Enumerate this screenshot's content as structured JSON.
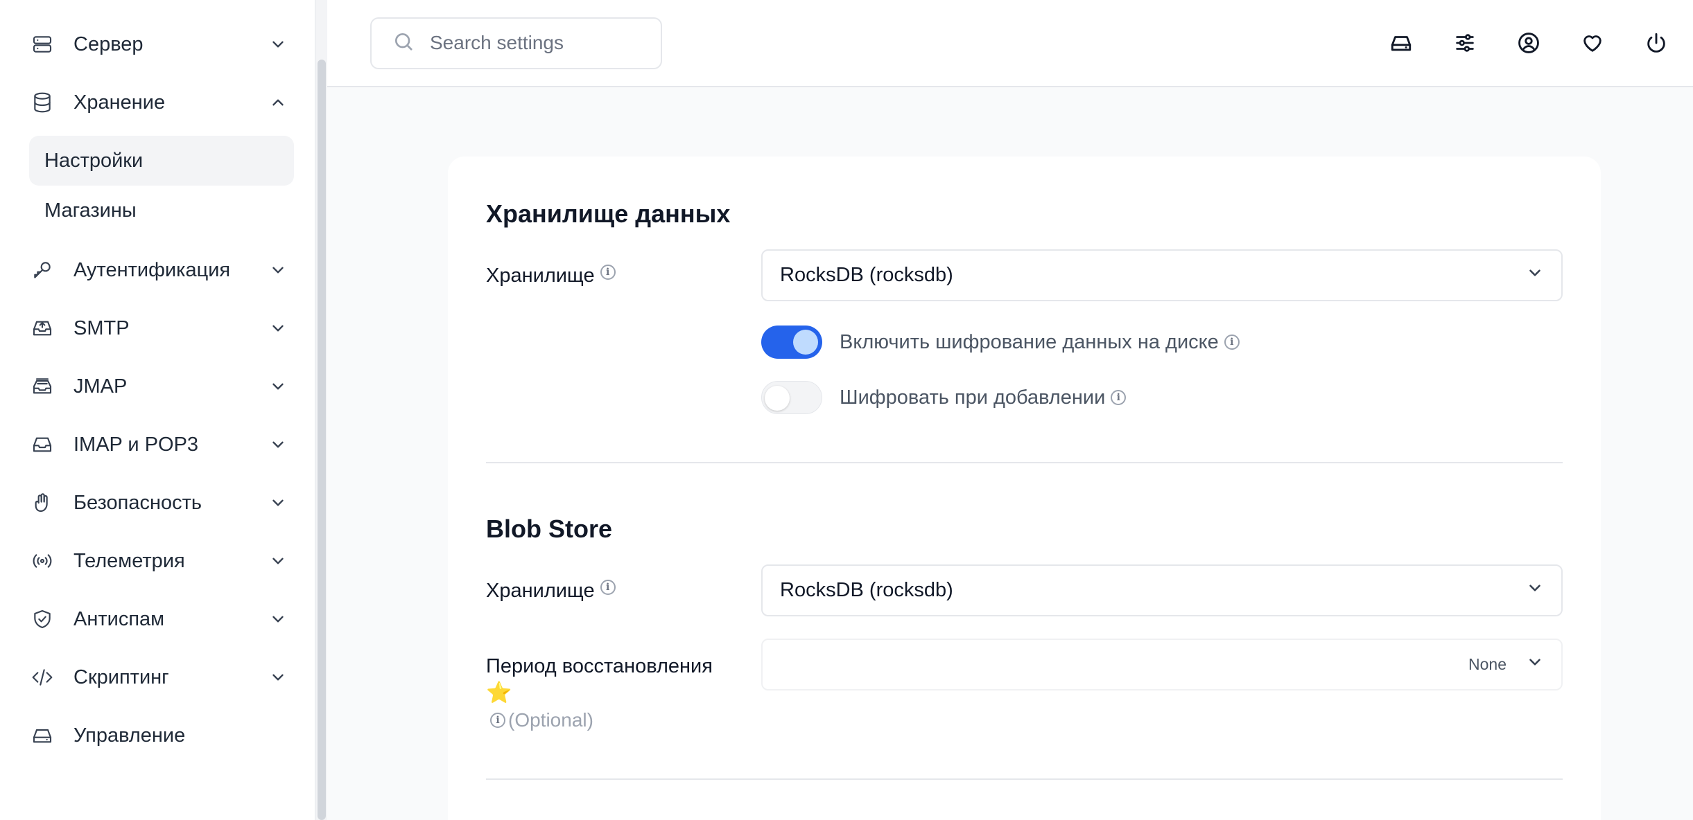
{
  "sidebar": {
    "items": [
      {
        "label": "Сервер",
        "icon": "server-icon",
        "expanded": false
      },
      {
        "label": "Хранение",
        "icon": "database-icon",
        "expanded": true,
        "children": [
          {
            "label": "Настройки",
            "active": true
          },
          {
            "label": "Магазины",
            "active": false
          }
        ]
      },
      {
        "label": "Аутентификация",
        "icon": "key-icon",
        "expanded": false
      },
      {
        "label": "SMTP",
        "icon": "inbox-upload-icon",
        "expanded": false
      },
      {
        "label": "JMAP",
        "icon": "inbox-stack-icon",
        "expanded": false
      },
      {
        "label": "IMAP и POP3",
        "icon": "inbox-icon",
        "expanded": false
      },
      {
        "label": "Безопасность",
        "icon": "hand-icon",
        "expanded": false
      },
      {
        "label": "Телеметрия",
        "icon": "signal-icon",
        "expanded": false
      },
      {
        "label": "Антиспам",
        "icon": "shield-check-icon",
        "expanded": false
      },
      {
        "label": "Скриптинг",
        "icon": "code-icon",
        "expanded": false
      },
      {
        "label": "Управление",
        "icon": "drive-icon",
        "expanded": null
      }
    ]
  },
  "search": {
    "placeholder": "Search settings",
    "value": ""
  },
  "topbar": {
    "icons": [
      "drive-icon",
      "sliders-icon",
      "user-circle-icon",
      "heart-icon",
      "power-icon"
    ]
  },
  "sections": [
    {
      "title": "Хранилище данных",
      "store_label": "Хранилище",
      "store_value": "RocksDB (rocksdb)",
      "toggles": [
        {
          "label": "Включить шифрование данных на диске",
          "on": true
        },
        {
          "label": "Шифровать при добавлении",
          "on": false
        }
      ]
    },
    {
      "title": "Blob Store",
      "store_label": "Хранилище",
      "store_value": "RocksDB (rocksdb)",
      "period_label": "Период восстановления",
      "period_star": "⭐",
      "period_optional": "(Optional)",
      "period_value": "None"
    }
  ],
  "colors": {
    "accent": "#2563eb",
    "sidebar_active": "#f3f4f6"
  }
}
